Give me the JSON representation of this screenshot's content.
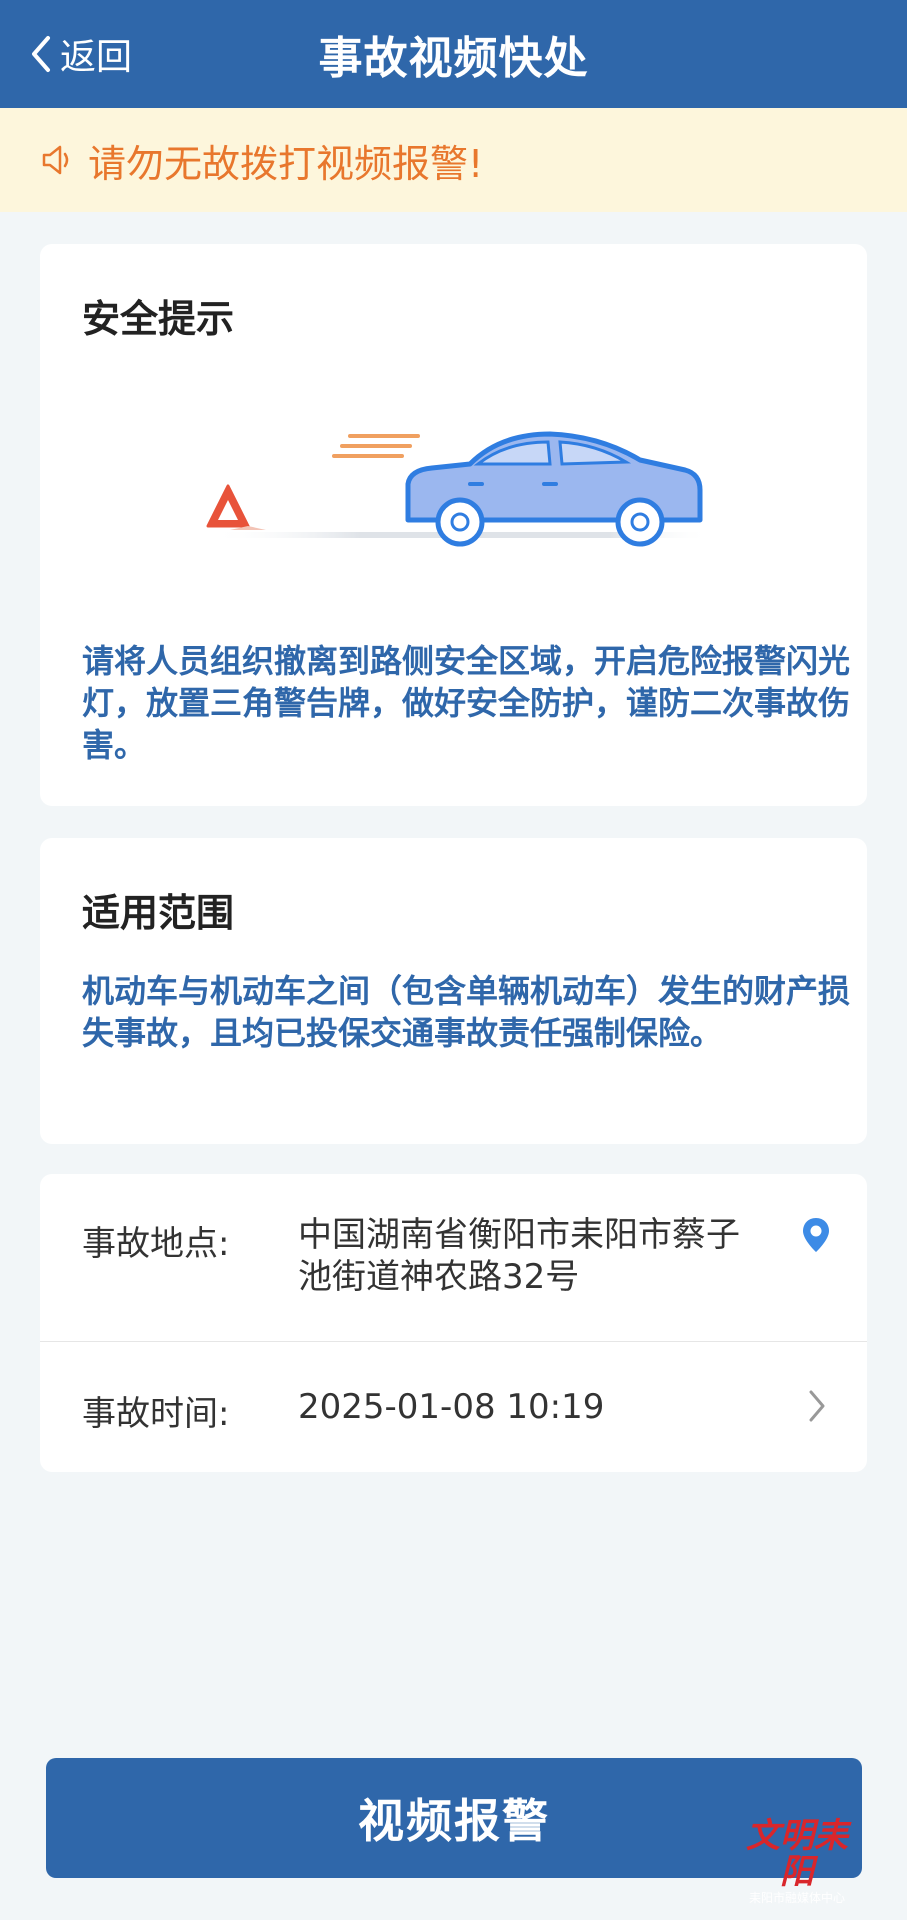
{
  "header": {
    "back_label": "返回",
    "title": "事故视频快处"
  },
  "banner": {
    "icon": "speaker-icon",
    "text": "请勿无故拨打视频报警!"
  },
  "safety_card": {
    "title": "安全提示",
    "illustration": "car-with-warning-triangle",
    "body": "请将人员组织撤离到路侧安全区域，开启危险报警闪光灯，放置三角警告牌，做好安全防护，谨防二次事故伤害。"
  },
  "scope_card": {
    "title": "适用范围",
    "body": "机动车与机动车之间（包含单辆机动车）发生的财产损失事故，且均已投保交通事故责任强制保险。"
  },
  "info": {
    "location_label": "事故地点:",
    "location_value": "中国湖南省衡阳市耒阳市蔡子池街道神农路32号",
    "location_icon": "location-pin-icon",
    "time_label": "事故时间:",
    "time_value": "2025-01-08 10:19",
    "time_icon": "chevron-right-icon"
  },
  "action": {
    "button_label": "视频报警"
  },
  "watermark": {
    "logo_text": "文明耒阳",
    "sub_text": "耒阳市融媒体中心"
  },
  "colors": {
    "primary": "#2f67aa",
    "warning_text": "#e8772d",
    "banner_bg": "#fdf6dc",
    "page_bg": "#f2f6f8"
  }
}
